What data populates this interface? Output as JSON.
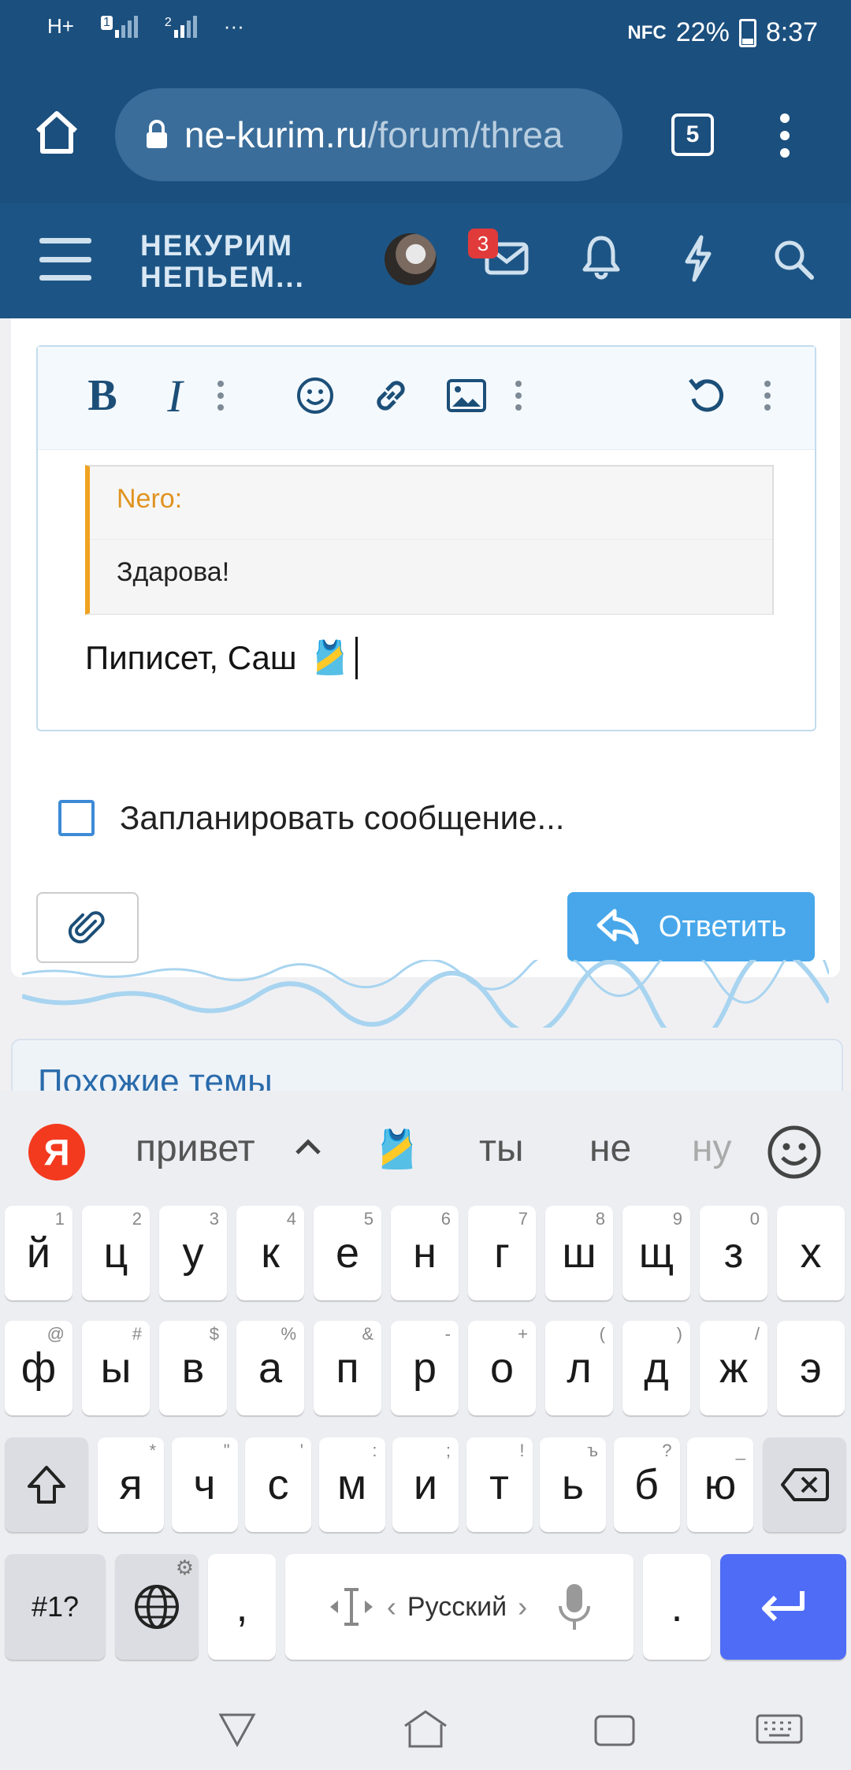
{
  "status_bar": {
    "network_h": "H+",
    "sim1_label": "1",
    "sim2_label": "2",
    "more": "···",
    "nfc": "NFC",
    "battery": "22%",
    "time": "8:37"
  },
  "browser": {
    "url_domain": "ne-kurim.ru",
    "url_path": "/forum/threa",
    "tab_count": "5"
  },
  "site_header": {
    "logo_line1": "НЕКУРИМ",
    "logo_line2": "НЕПЬЕМ...",
    "messages_badge": "3"
  },
  "editor": {
    "quote_author": "Nero:",
    "quote_text": "Здарова!",
    "reply_text": "Пиписет, Саш",
    "reply_emoji": "🎽"
  },
  "form": {
    "schedule_label": "Запланировать сообщение...",
    "reply_button": "Ответить"
  },
  "similar": {
    "title": "Похожие темы"
  },
  "keyboard": {
    "brand_letter": "Я",
    "suggestions": [
      "привет",
      "🎽",
      "ты",
      "не",
      "ну"
    ],
    "row1": [
      {
        "k": "й",
        "h": "1"
      },
      {
        "k": "ц",
        "h": "2"
      },
      {
        "k": "у",
        "h": "3"
      },
      {
        "k": "к",
        "h": "4"
      },
      {
        "k": "е",
        "h": "5"
      },
      {
        "k": "н",
        "h": "6"
      },
      {
        "k": "г",
        "h": "7"
      },
      {
        "k": "ш",
        "h": "8"
      },
      {
        "k": "щ",
        "h": "9"
      },
      {
        "k": "з",
        "h": "0"
      },
      {
        "k": "х",
        "h": ""
      }
    ],
    "row2": [
      {
        "k": "ф",
        "h": "@"
      },
      {
        "k": "ы",
        "h": "#"
      },
      {
        "k": "в",
        "h": "$"
      },
      {
        "k": "а",
        "h": "%"
      },
      {
        "k": "п",
        "h": "&"
      },
      {
        "k": "р",
        "h": "-"
      },
      {
        "k": "о",
        "h": "+"
      },
      {
        "k": "л",
        "h": "("
      },
      {
        "k": "д",
        "h": ")"
      },
      {
        "k": "ж",
        "h": "/"
      },
      {
        "k": "э",
        "h": ""
      }
    ],
    "row3": [
      {
        "k": "я",
        "h": "*"
      },
      {
        "k": "ч",
        "h": "\""
      },
      {
        "k": "с",
        "h": "'"
      },
      {
        "k": "м",
        "h": ":"
      },
      {
        "k": "и",
        "h": ";"
      },
      {
        "k": "т",
        "h": "!"
      },
      {
        "k": "ь",
        "h": "ъ"
      },
      {
        "k": "б",
        "h": "?"
      },
      {
        "k": "ю",
        "h": "_"
      }
    ],
    "symbols_label": "#1?",
    "comma": ",",
    "space_label": "Русский",
    "period": "."
  }
}
